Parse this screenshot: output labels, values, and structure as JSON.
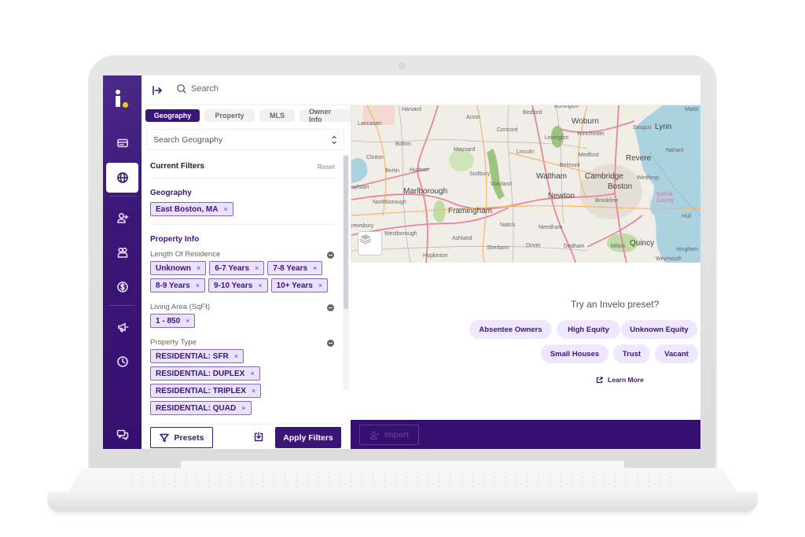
{
  "app": {
    "name": "Invelo",
    "brand_color": "#3a1677",
    "accent_dot_color": "#f6c423"
  },
  "nav": {
    "items": [
      {
        "icon": "credit-card-icon",
        "active": false
      },
      {
        "icon": "globe-icon",
        "active": true
      },
      {
        "icon": "add-user-icon",
        "active": false
      },
      {
        "icon": "users-icon",
        "active": false
      },
      {
        "icon": "dollar-icon",
        "active": false
      },
      {
        "icon": "megaphone-icon",
        "active": false
      },
      {
        "icon": "clock-icon",
        "active": false
      }
    ],
    "bottom_icon": "chat-icon"
  },
  "topbar": {
    "collapse_icon": "expand-right-icon",
    "search_placeholder": "Search"
  },
  "filter_panel": {
    "tabs": [
      {
        "label": "Geography",
        "active": true
      },
      {
        "label": "Property",
        "active": false
      },
      {
        "label": "MLS",
        "active": false
      },
      {
        "label": "Owner Info",
        "active": false
      }
    ],
    "geography_search_placeholder": "Search Geography",
    "current_filters": {
      "title": "Current Filters",
      "reset_label": "Reset",
      "geography": {
        "title": "Geography",
        "chips": [
          "East Boston, MA"
        ]
      },
      "property_info": {
        "title": "Property Info",
        "groups": [
          {
            "label": "Length Of Residence",
            "chips": [
              "Unknown",
              "6-7 Years",
              "7-8 Years",
              "8-9 Years",
              "9-10 Years",
              "10+ Years"
            ]
          },
          {
            "label": "Living Area (SqFt)",
            "chips": [
              "1 - 850"
            ]
          },
          {
            "label": "Property Type",
            "chips": [
              "RESIDENTIAL: SFR",
              "RESIDENTIAL: DUPLEX",
              "RESIDENTIAL: TRIPLEX",
              "RESIDENTIAL: QUAD"
            ]
          }
        ]
      }
    },
    "chip_remove_glyph": "×",
    "footer": {
      "presets_label": "Presets",
      "apply_label": "Apply Filters"
    }
  },
  "map": {
    "labels_large": [
      "Marlborough",
      "Framingham",
      "Waltham",
      "Cambridge",
      "Boston",
      "Newton",
      "Quincy",
      "Woburn",
      "Revere",
      "Lynn"
    ],
    "labels_small": [
      "Harvard",
      "Acton",
      "Bedford",
      "Burlington",
      "Lancaster",
      "Concord",
      "Lexington",
      "Winchester",
      "Saugus",
      "Marbl",
      "Bolton",
      "Maynard",
      "Lincoln",
      "Medford",
      "Nahant",
      "Clinton",
      "Hudson",
      "Sudbury",
      "Belmont",
      "Winthrop",
      "Berlin",
      "Wayland",
      "oylston",
      "Brookline",
      "Northborough",
      "Hull",
      "rewsbury",
      "Natick",
      "Needham",
      "Westborough",
      "Ashland",
      "Sherborn",
      "Dover",
      "Dedham",
      "Milton",
      "Hingham",
      "Hopkinton",
      "Weymouth",
      "Suffolk County"
    ],
    "layers_icon": "layers-icon"
  },
  "presets": {
    "prompt": "Try an Invelo preset?",
    "row1": [
      "Absentee Owners",
      "High Equity",
      "Unknown Equity"
    ],
    "row2": [
      "Small Houses",
      "Trust",
      "Vacant"
    ],
    "learn_more": "Learn More"
  },
  "bottom_bar": {
    "import_label": "Import"
  }
}
